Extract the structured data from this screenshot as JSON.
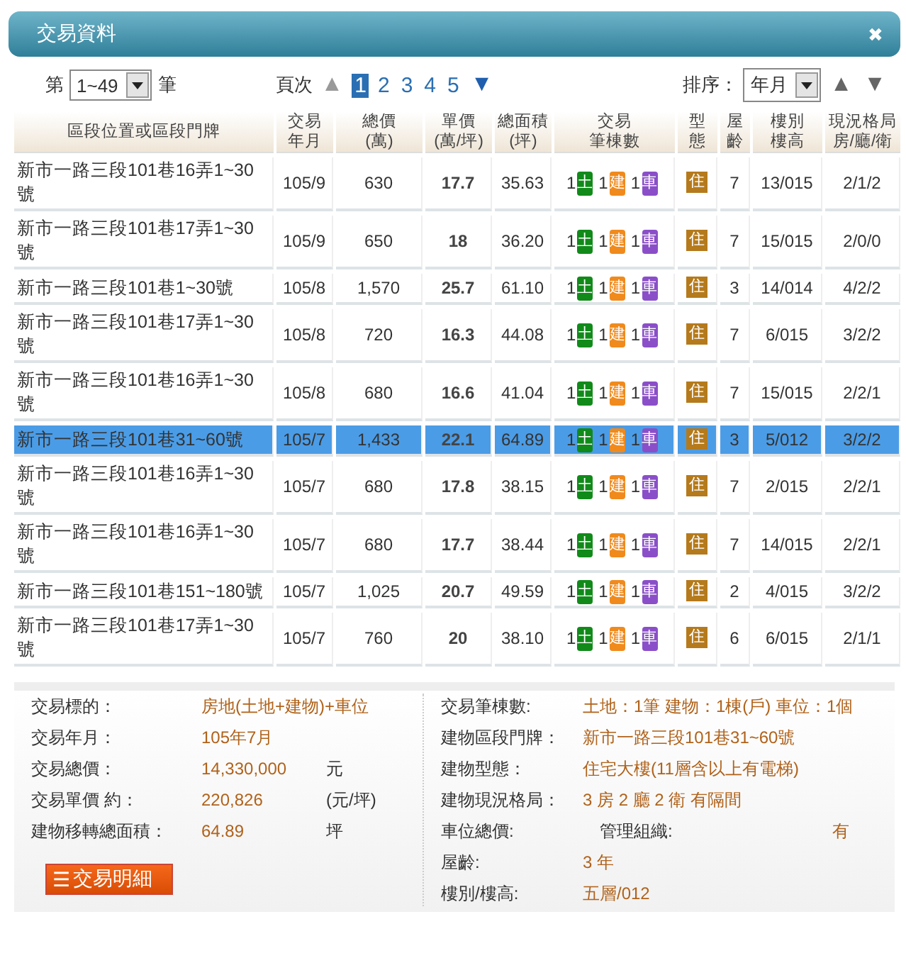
{
  "window": {
    "title": "交易資料",
    "close": "✖"
  },
  "range": {
    "prefix": "第",
    "value": "1~49",
    "suffix": "筆"
  },
  "pager": {
    "label": "頁次",
    "prev": "▲",
    "next": "▼",
    "pages": [
      {
        "label": "1",
        "selected": true
      },
      {
        "label": "2",
        "selected": false
      },
      {
        "label": "3",
        "selected": false
      },
      {
        "label": "4",
        "selected": false
      },
      {
        "label": "5",
        "selected": false
      }
    ]
  },
  "sort": {
    "label": "排序：",
    "value": "年月",
    "asc": "▲",
    "desc": "▼"
  },
  "table": {
    "columns": [
      {
        "lines": [
          "區段位置或區段門牌"
        ]
      },
      {
        "lines": [
          "交易",
          "年月"
        ]
      },
      {
        "lines": [
          "總價",
          "(萬)"
        ]
      },
      {
        "lines": [
          "單價",
          "(萬/坪)"
        ]
      },
      {
        "lines": [
          "總面積",
          "(坪)"
        ]
      },
      {
        "lines": [
          "交易",
          "筆棟數"
        ]
      },
      {
        "lines": [
          "型",
          "態"
        ]
      },
      {
        "lines": [
          "屋",
          "齡"
        ]
      },
      {
        "lines": [
          "樓別",
          "樓高"
        ]
      },
      {
        "lines": [
          "現況格局",
          "房/廳/衛"
        ]
      }
    ],
    "rows": [
      {
        "selected": false,
        "address": "新市一路三段101巷16弄1~30號",
        "date": "105/9",
        "total": "630",
        "unit": "17.7",
        "area": "35.63",
        "counts": [
          {
            "num": "1",
            "label": "土",
            "color": "#118a1a"
          },
          {
            "num": "1",
            "label": "建",
            "color": "#f08a1c"
          },
          {
            "num": "1",
            "label": "車",
            "color": "#8a4fc8"
          }
        ],
        "type": "住",
        "age": "7",
        "floor": "13/015",
        "layout": "2/1/2"
      },
      {
        "selected": false,
        "address": "新市一路三段101巷17弄1~30號",
        "date": "105/9",
        "total": "650",
        "unit": "18",
        "area": "36.20",
        "counts": [
          {
            "num": "1",
            "label": "土",
            "color": "#118a1a"
          },
          {
            "num": "1",
            "label": "建",
            "color": "#f08a1c"
          },
          {
            "num": "1",
            "label": "車",
            "color": "#8a4fc8"
          }
        ],
        "type": "住",
        "age": "7",
        "floor": "15/015",
        "layout": "2/0/0"
      },
      {
        "selected": false,
        "address": "新市一路三段101巷1~30號",
        "date": "105/8",
        "total": "1,570",
        "unit": "25.7",
        "area": "61.10",
        "counts": [
          {
            "num": "1",
            "label": "土",
            "color": "#118a1a"
          },
          {
            "num": "1",
            "label": "建",
            "color": "#f08a1c"
          },
          {
            "num": "1",
            "label": "車",
            "color": "#8a4fc8"
          }
        ],
        "type": "住",
        "age": "3",
        "floor": "14/014",
        "layout": "4/2/2"
      },
      {
        "selected": false,
        "address": "新市一路三段101巷17弄1~30號",
        "date": "105/8",
        "total": "720",
        "unit": "16.3",
        "area": "44.08",
        "counts": [
          {
            "num": "1",
            "label": "土",
            "color": "#118a1a"
          },
          {
            "num": "1",
            "label": "建",
            "color": "#f08a1c"
          },
          {
            "num": "1",
            "label": "車",
            "color": "#8a4fc8"
          }
        ],
        "type": "住",
        "age": "7",
        "floor": "6/015",
        "layout": "3/2/2"
      },
      {
        "selected": false,
        "address": "新市一路三段101巷16弄1~30號",
        "date": "105/8",
        "total": "680",
        "unit": "16.6",
        "area": "41.04",
        "counts": [
          {
            "num": "1",
            "label": "土",
            "color": "#118a1a"
          },
          {
            "num": "1",
            "label": "建",
            "color": "#f08a1c"
          },
          {
            "num": "1",
            "label": "車",
            "color": "#8a4fc8"
          }
        ],
        "type": "住",
        "age": "7",
        "floor": "15/015",
        "layout": "2/2/1"
      },
      {
        "selected": true,
        "address": "新市一路三段101巷31~60號",
        "date": "105/7",
        "total": "1,433",
        "unit": "22.1",
        "area": "64.89",
        "counts": [
          {
            "num": "1",
            "label": "土",
            "color": "#118a1a"
          },
          {
            "num": "1",
            "label": "建",
            "color": "#f08a1c"
          },
          {
            "num": "1",
            "label": "車",
            "color": "#8a4fc8"
          }
        ],
        "type": "住",
        "age": "3",
        "floor": "5/012",
        "layout": "3/2/2"
      },
      {
        "selected": false,
        "address": "新市一路三段101巷16弄1~30號",
        "date": "105/7",
        "total": "680",
        "unit": "17.8",
        "area": "38.15",
        "counts": [
          {
            "num": "1",
            "label": "土",
            "color": "#118a1a"
          },
          {
            "num": "1",
            "label": "建",
            "color": "#f08a1c"
          },
          {
            "num": "1",
            "label": "車",
            "color": "#8a4fc8"
          }
        ],
        "type": "住",
        "age": "7",
        "floor": "2/015",
        "layout": "2/2/1"
      },
      {
        "selected": false,
        "address": "新市一路三段101巷16弄1~30號",
        "date": "105/7",
        "total": "680",
        "unit": "17.7",
        "area": "38.44",
        "counts": [
          {
            "num": "1",
            "label": "土",
            "color": "#118a1a"
          },
          {
            "num": "1",
            "label": "建",
            "color": "#f08a1c"
          },
          {
            "num": "1",
            "label": "車",
            "color": "#8a4fc8"
          }
        ],
        "type": "住",
        "age": "7",
        "floor": "14/015",
        "layout": "2/2/1"
      },
      {
        "selected": false,
        "address": "新市一路三段101巷151~180號",
        "date": "105/7",
        "total": "1,025",
        "unit": "20.7",
        "area": "49.59",
        "counts": [
          {
            "num": "1",
            "label": "土",
            "color": "#118a1a"
          },
          {
            "num": "1",
            "label": "建",
            "color": "#f08a1c"
          },
          {
            "num": "1",
            "label": "車",
            "color": "#8a4fc8"
          }
        ],
        "type": "住",
        "age": "2",
        "floor": "4/015",
        "layout": "3/2/2"
      },
      {
        "selected": false,
        "address": "新市一路三段101巷17弄1~30號",
        "date": "105/7",
        "total": "760",
        "unit": "20",
        "area": "38.10",
        "counts": [
          {
            "num": "1",
            "label": "土",
            "color": "#118a1a"
          },
          {
            "num": "1",
            "label": "建",
            "color": "#f08a1c"
          },
          {
            "num": "1",
            "label": "車",
            "color": "#8a4fc8"
          }
        ],
        "type": "住",
        "age": "6",
        "floor": "6/015",
        "layout": "2/1/1"
      }
    ]
  },
  "details": {
    "left": [
      {
        "label": "交易標的：",
        "value": "房地(土地+建物)+車位"
      },
      {
        "label": "交易年月：",
        "value": "105年7月"
      },
      {
        "label": "交易總價：",
        "value": "14,330,000",
        "unit": "元"
      },
      {
        "label": "交易單價 約：",
        "value": "220,826",
        "unit": "(元/坪)"
      },
      {
        "label": "建物移轉總面積：",
        "value": "64.89",
        "unit": "坪"
      }
    ],
    "button": {
      "icon": "☰",
      "label": "交易明細"
    },
    "right": [
      {
        "kind": "single",
        "label": "交易筆棟數:",
        "value": "土地：1筆 建物：1棟(戶) 車位：1個"
      },
      {
        "kind": "single",
        "label": "建物區段門牌：",
        "value": "新市一路三段101巷31~60號"
      },
      {
        "kind": "single",
        "label": "建物型態：",
        "value": "住宅大樓(11層含以上有電梯)"
      },
      {
        "kind": "single",
        "label": "建物現況格局：",
        "value": "3 房 2 廳 2 衛 有隔間"
      },
      {
        "kind": "pair",
        "label": "車位總價:",
        "label2": "管理組織:",
        "value2": "有"
      },
      {
        "kind": "single",
        "label": "屋齡:",
        "value": "3 年"
      },
      {
        "kind": "single",
        "label": "樓別/樓高:",
        "value": "五層/012"
      }
    ]
  }
}
